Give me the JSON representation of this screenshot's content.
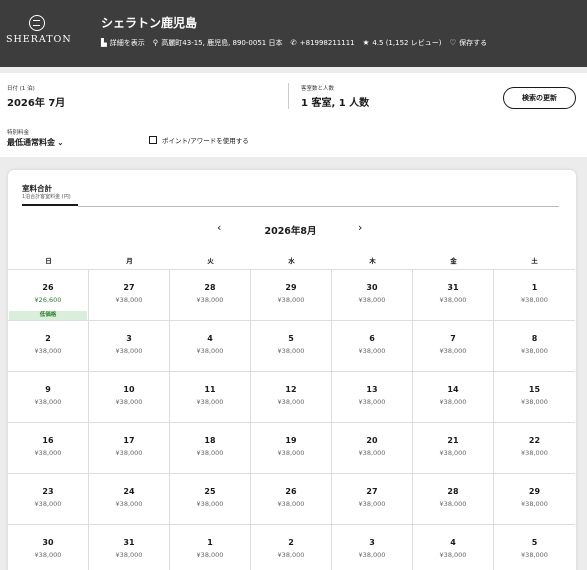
{
  "header": {
    "logo_text": "SHERATON",
    "hotel_name": "シェラトン鹿児島",
    "details_label": "詳細を表示",
    "address": "高麗町43-15, 鹿児島, 890-0051 日本",
    "phone": "+81998211111",
    "rating": "4.5 (1,152 レビュー)",
    "save_label": "保存する"
  },
  "search": {
    "date_label": "日付 (1 泊)",
    "date_value": "2026年 7月",
    "rooms_label": "客室数と人数",
    "rooms_value": "1 客室, 1 人数",
    "update_button": "検索の更新"
  },
  "rates": {
    "label": "特別料金",
    "value": "最低通常料金",
    "points_label": "ポイント/アワードを使用する"
  },
  "calendar": {
    "tab_title": "室料合計",
    "tab_subtitle": "1泊合計客室料金 (円)",
    "month": "2026年8月",
    "prev": "‹",
    "next": "›",
    "weekdays": [
      "日",
      "月",
      "火",
      "水",
      "木",
      "金",
      "土"
    ],
    "weeks": [
      [
        {
          "day": "26",
          "price": "¥26,600",
          "badge": "低価格",
          "low": true
        },
        {
          "day": "27",
          "price": "¥38,000"
        },
        {
          "day": "28",
          "price": "¥38,000"
        },
        {
          "day": "29",
          "price": "¥38,000"
        },
        {
          "day": "30",
          "price": "¥38,000"
        },
        {
          "day": "31",
          "price": "¥38,000"
        },
        {
          "day": "1",
          "price": "¥38,000"
        }
      ],
      [
        {
          "day": "2",
          "price": "¥38,000"
        },
        {
          "day": "3",
          "price": "¥38,000"
        },
        {
          "day": "4",
          "price": "¥38,000"
        },
        {
          "day": "5",
          "price": "¥38,000"
        },
        {
          "day": "6",
          "price": "¥38,000"
        },
        {
          "day": "7",
          "price": "¥38,000"
        },
        {
          "day": "8",
          "price": "¥38,000"
        }
      ],
      [
        {
          "day": "9",
          "price": "¥38,000"
        },
        {
          "day": "10",
          "price": "¥38,000"
        },
        {
          "day": "11",
          "price": "¥38,000"
        },
        {
          "day": "12",
          "price": "¥38,000"
        },
        {
          "day": "13",
          "price": "¥38,000"
        },
        {
          "day": "14",
          "price": "¥38,000"
        },
        {
          "day": "15",
          "price": "¥38,000"
        }
      ],
      [
        {
          "day": "16",
          "price": "¥38,000"
        },
        {
          "day": "17",
          "price": "¥38,000"
        },
        {
          "day": "18",
          "price": "¥38,000"
        },
        {
          "day": "19",
          "price": "¥38,000"
        },
        {
          "day": "20",
          "price": "¥38,000"
        },
        {
          "day": "21",
          "price": "¥38,000"
        },
        {
          "day": "22",
          "price": "¥38,000"
        }
      ],
      [
        {
          "day": "23",
          "price": "¥38,000"
        },
        {
          "day": "24",
          "price": "¥38,000"
        },
        {
          "day": "25",
          "price": "¥38,000"
        },
        {
          "day": "26",
          "price": "¥38,000"
        },
        {
          "day": "27",
          "price": "¥38,000"
        },
        {
          "day": "28",
          "price": "¥38,000"
        },
        {
          "day": "29",
          "price": "¥38,000"
        }
      ],
      [
        {
          "day": "30",
          "price": "¥38,000"
        },
        {
          "day": "31",
          "price": "¥38,000"
        },
        {
          "day": "1",
          "price": "¥38,000"
        },
        {
          "day": "2",
          "price": "¥38,000"
        },
        {
          "day": "3",
          "price": "¥38,000"
        },
        {
          "day": "4",
          "price": "¥38,000"
        },
        {
          "day": "5",
          "price": "¥38,000"
        }
      ]
    ]
  },
  "colors": {
    "header_bg": "#3d3d3d",
    "low_price_green": "#2e7d32",
    "badge_bg": "#d9efd9"
  },
  "icons": [
    "sheraton-logo",
    "building-icon",
    "location-pin-icon",
    "phone-icon",
    "star-icon",
    "heart-icon",
    "chevron-down-icon",
    "chevron-left-icon",
    "chevron-right-icon"
  ]
}
